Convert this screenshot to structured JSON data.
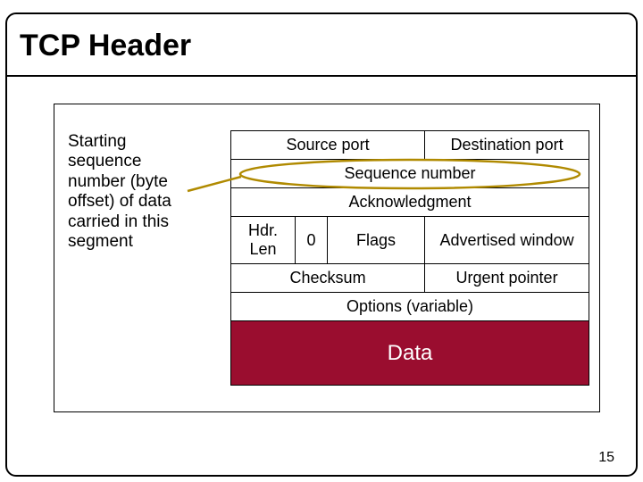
{
  "slide": {
    "title": "TCP Header",
    "page_number": "15"
  },
  "annotation": "Starting sequence number (byte offset) of data carried in this segment",
  "header_rows": {
    "r1a": "Source port",
    "r1b": "Destination port",
    "r2": "Sequence number",
    "r3": "Acknowledgment",
    "r4a": "Hdr. Len",
    "r4b": "0",
    "r4c": "Flags",
    "r4d": "Advertised window",
    "r5a": "Checksum",
    "r5b": "Urgent pointer",
    "r6": "Options (variable)",
    "r7": "Data"
  },
  "colors": {
    "data_bg": "#9a0d2f",
    "callout": "#b08a00"
  }
}
